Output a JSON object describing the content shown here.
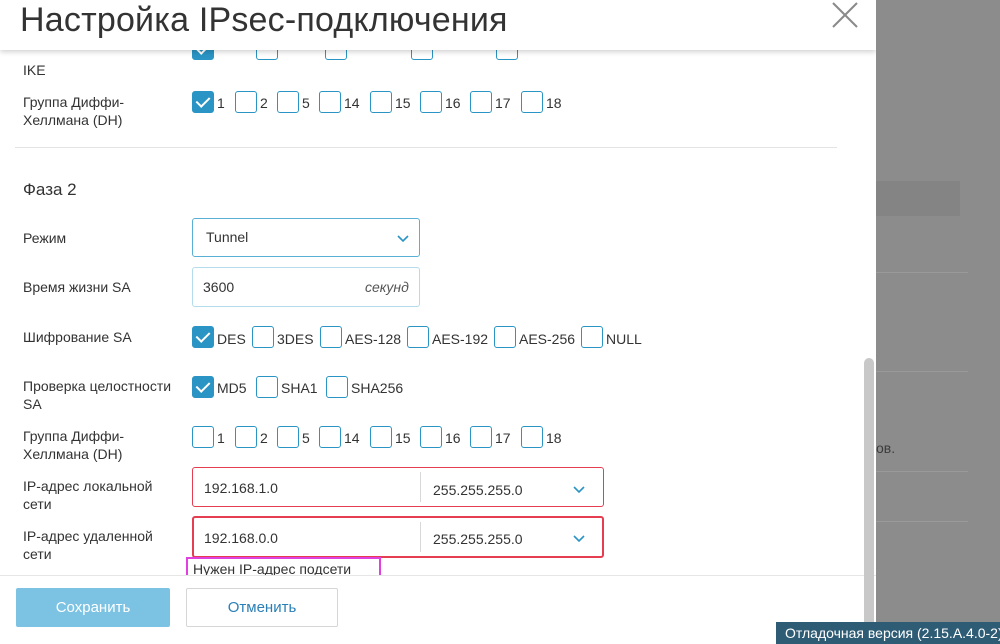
{
  "title": "Настройка IPsec-подключения",
  "background": {
    "text": "ов."
  },
  "phase1": {
    "ike_label_tail": "IKE",
    "dh_label": "Группа Диффи-Хеллмана (DH)",
    "dh_options": [
      {
        "label": "1",
        "checked": true
      },
      {
        "label": "2",
        "checked": false
      },
      {
        "label": "5",
        "checked": false
      },
      {
        "label": "14",
        "checked": false
      },
      {
        "label": "15",
        "checked": false
      },
      {
        "label": "16",
        "checked": false
      },
      {
        "label": "17",
        "checked": false
      },
      {
        "label": "18",
        "checked": false
      }
    ]
  },
  "phase2": {
    "title": "Фаза 2",
    "mode_label": "Режим",
    "mode_value": "Tunnel",
    "sa_lifetime_label": "Время жизни SA",
    "sa_lifetime_value": "3600",
    "sa_lifetime_unit": "секунд",
    "encryption_label": "Шифрование SA",
    "encryption_options": [
      {
        "label": "DES",
        "checked": true
      },
      {
        "label": "3DES",
        "checked": false
      },
      {
        "label": "AES-128",
        "checked": false
      },
      {
        "label": "AES-192",
        "checked": false
      },
      {
        "label": "AES-256",
        "checked": false
      },
      {
        "label": "NULL",
        "checked": false
      }
    ],
    "integrity_label": "Проверка целостности SA",
    "integrity_options": [
      {
        "label": "MD5",
        "checked": true
      },
      {
        "label": "SHA1",
        "checked": false
      },
      {
        "label": "SHA256",
        "checked": false
      }
    ],
    "dh_label": "Группа Диффи-Хеллмана (DH)",
    "dh_options": [
      {
        "label": "1",
        "checked": false
      },
      {
        "label": "2",
        "checked": false
      },
      {
        "label": "5",
        "checked": false
      },
      {
        "label": "14",
        "checked": false
      },
      {
        "label": "15",
        "checked": false
      },
      {
        "label": "16",
        "checked": false
      },
      {
        "label": "17",
        "checked": false
      },
      {
        "label": "18",
        "checked": false
      }
    ],
    "local_ip_label": "IP-адрес локальной сети",
    "local_ip_value": "192.168.1.0",
    "local_mask_value": "255.255.255.0",
    "remote_ip_label": "IP-адрес удаленной сети",
    "remote_ip_value": "192.168.0.0",
    "remote_mask_value": "255.255.255.0",
    "remote_error": "Нужен IP-адрес подсети"
  },
  "footer": {
    "save_label": "Сохранить",
    "cancel_label": "Отменить"
  },
  "debug_version": "Отладочная версия (2.15.A.4.0-2)",
  "colors": {
    "accent": "#2a94c4",
    "error": "#e53e50",
    "highlight": "#e040e0",
    "save_button": "#7cc3e3"
  }
}
